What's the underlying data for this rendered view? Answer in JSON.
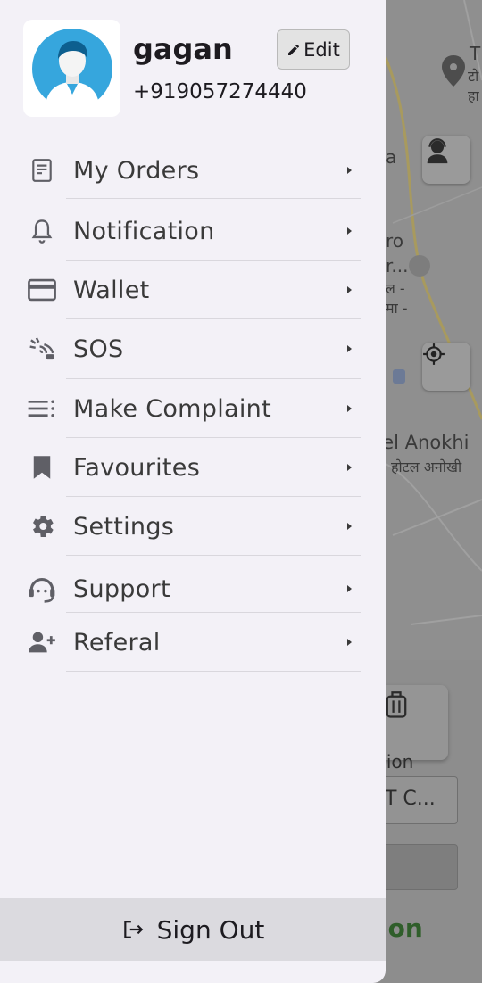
{
  "user": {
    "name": "gagan",
    "phone": "+919057274440",
    "edit_label": "Edit"
  },
  "menu": [
    {
      "label": "My Orders",
      "icon": "orders-icon"
    },
    {
      "label": "Notification",
      "icon": "bell-icon"
    },
    {
      "label": "Wallet",
      "icon": "credit-card-icon"
    },
    {
      "label": "SOS",
      "icon": "sos-signal-icon"
    },
    {
      "label": "Make Complaint",
      "icon": "list-icon"
    },
    {
      "label": "Favourites",
      "icon": "bookmark-icon"
    },
    {
      "label": "Settings",
      "icon": "gear-icon"
    },
    {
      "label": "Support",
      "icon": "support-agent-icon"
    },
    {
      "label": "Referal",
      "icon": "add-person-icon"
    }
  ],
  "sign_out_label": "Sign Out",
  "map": {
    "labels": [
      "T",
      "टो",
      "हा",
      "a",
      "ro",
      "r...",
      "ल -",
      "मा -",
      "tel Anokhi",
      "होटल अनोखी"
    ]
  },
  "background": {
    "caption": "tion",
    "field_value": "T C...",
    "action_label": "ion"
  },
  "colors": {
    "drawer_bg": "#f3f1f7",
    "text": "#1d1b20",
    "icon": "#5f5f66",
    "action_green": "#2f5e2a"
  }
}
